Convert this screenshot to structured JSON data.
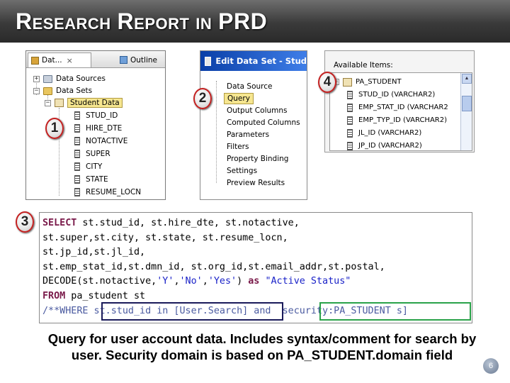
{
  "title": {
    "word1_initial": "R",
    "word1_rest": "ESEARCH",
    "word2_initial": "R",
    "word2_rest": "EPORT",
    "word3": "IN",
    "word4": "PRD"
  },
  "markers": [
    "1",
    "2",
    "3",
    "4"
  ],
  "explorer": {
    "tab_data": "Dat...",
    "tab_outline": "Outline",
    "tab_close": "×",
    "tree": [
      {
        "label": "Data Sources",
        "toggle": "+"
      },
      {
        "label": "Data Sets",
        "toggle": "−"
      },
      {
        "label": "Student Data",
        "toggle": "−"
      }
    ],
    "columns": [
      "STUD_ID",
      "HIRE_DTE",
      "NOTACTIVE",
      "SUPER",
      "CITY",
      "STATE",
      "RESUME_LOCN"
    ]
  },
  "edit_data_set": {
    "title": "Edit Data Set - Stud",
    "items": [
      "Data Source",
      "Query",
      "Output Columns",
      "Computed Columns",
      "Parameters",
      "Filters",
      "Property Binding",
      "Settings",
      "Preview Results"
    ],
    "selected": "Query"
  },
  "available_items": {
    "header": "Available Items:",
    "table": "PA_STUDENT",
    "columns": [
      "STUD_ID (VARCHAR2)",
      "EMP_STAT_ID (VARCHAR2",
      "EMP_TYP_ID (VARCHAR2)",
      "JL_ID (VARCHAR2)",
      "JP_ID (VARCHAR2)"
    ]
  },
  "query": {
    "line1_kw": "SELECT",
    "line1": " st.stud_id, st.hire_dte, st.notactive,",
    "line2": "st.super,st.city, st.state, st.resume_locn,",
    "line3": "st.jp_id,st.jl_id,",
    "line4": "st.emp_stat_id,st.dmn_id, st.org_id,st.email_addr,st.postal,",
    "line5_a": "DECODE(st.notactive,",
    "line5_s1": "'Y'",
    "line5_b": ",",
    "line5_s2": "'No'",
    "line5_c": ",",
    "line5_s3": "'Yes'",
    "line5_d": ") ",
    "line5_kw": "as",
    "line5_e": " ",
    "line5_s4": "\"Active Status\"",
    "line6_kw": "FROM",
    "line6": " pa_student st",
    "line7_cmt": "/**WHERE",
    "line7_a": " st.stud_id in [User.Search] ",
    "line7_and": "and",
    "line7_b": "  security:PA_STUDENT s]"
  },
  "caption": {
    "line1": "Query for user account data. Includes syntax/comment for search by",
    "line2": "user. Security domain is based on PA_STUDENT.domain field"
  },
  "page_number": "6",
  "colors": {
    "title_bar": "#3a3a3a",
    "selection": "#f6e690",
    "dialog_header": "#0a3fa8",
    "user_search_box": "#1a1a5a",
    "security_box": "#2aa24a",
    "marker_ring": "#c42020"
  }
}
